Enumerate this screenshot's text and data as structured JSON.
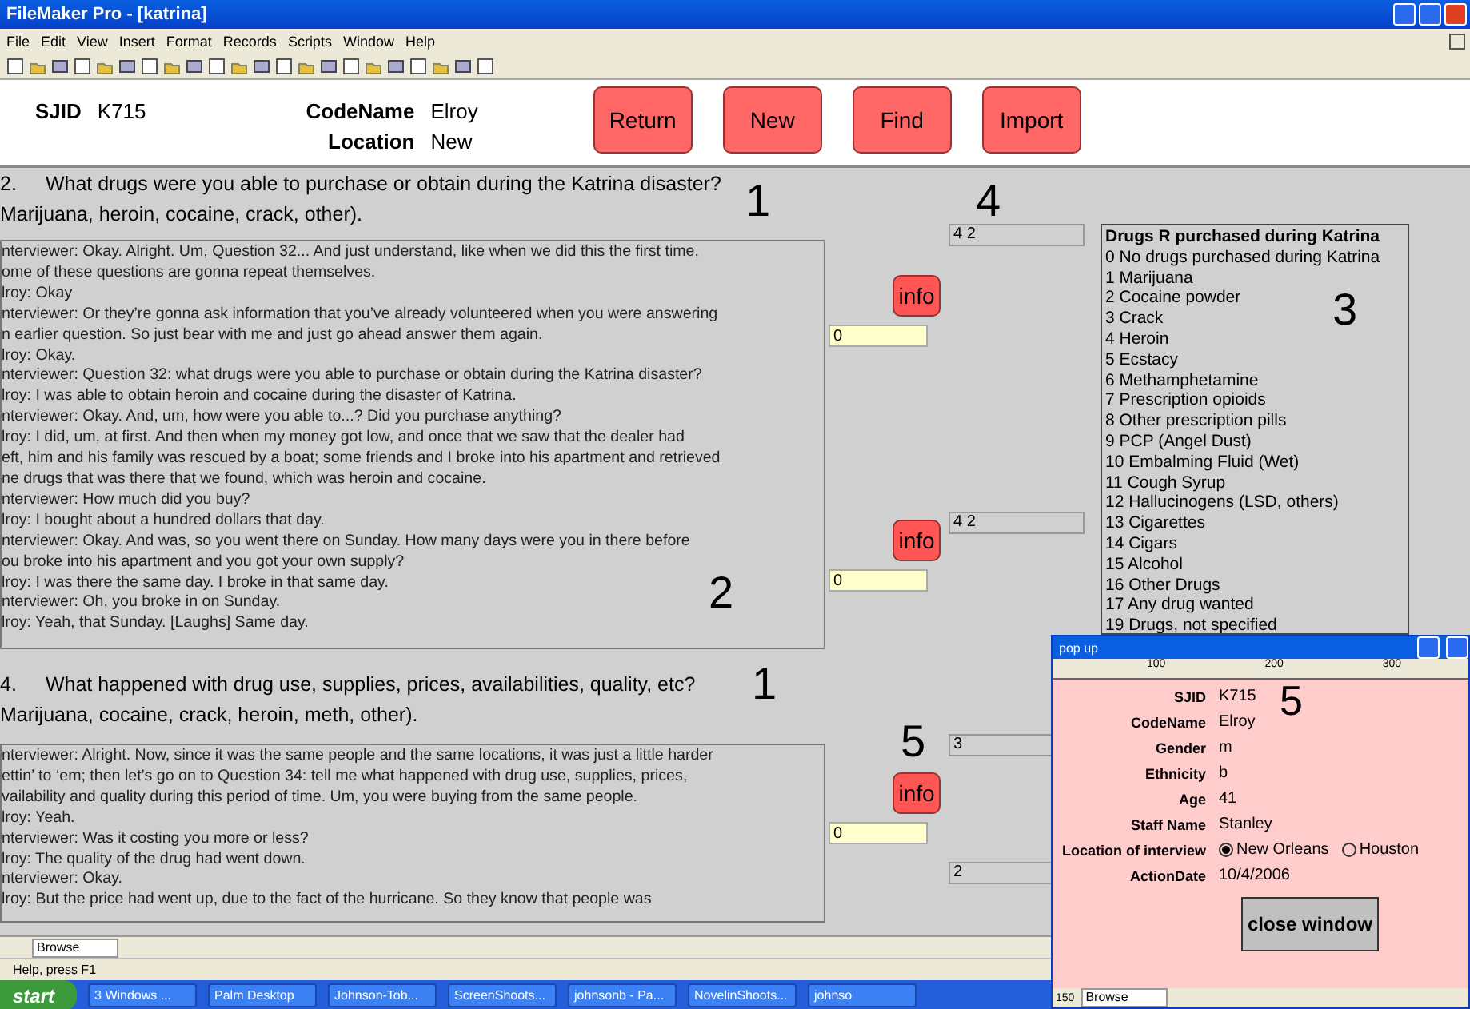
{
  "window": {
    "title": "FileMaker Pro - [katrina]"
  },
  "menu": [
    "File",
    "Edit",
    "View",
    "Insert",
    "Format",
    "Records",
    "Scripts",
    "Window",
    "Help"
  ],
  "header": {
    "fields": [
      {
        "label": "SJID",
        "value": "K715"
      },
      {
        "label": "CodeName",
        "value": "Elroy"
      },
      {
        "label": "Location",
        "value": "New"
      }
    ],
    "buttons": [
      "Return",
      "New",
      "Find",
      "Import"
    ]
  },
  "questions": [
    {
      "number": "2.",
      "text": "What drugs were you able to purchase or obtain during the Katrina disaster?",
      "subtext": "Marijuana, heroin, cocaine, crack, other).",
      "transcript": [
        "nterviewer:  Okay. Alright. Um, Question 32... And just understand, like when we did this the first time,",
        "ome of these questions are gonna repeat themselves.",
        "lroy:  Okay",
        "nterviewer:  Or they’re gonna ask information that you’ve already volunteered when you were answering",
        "n earlier question. So just bear with me and just go ahead answer them again.",
        "lroy:  Okay.",
        "nterviewer:  Question 32: what drugs were you able to purchase or obtain during the Katrina disaster?",
        "lroy:  I was able to obtain heroin and cocaine during the disaster of Katrina.",
        "nterviewer:  Okay. And, um, how were you able to...? Did you purchase anything?",
        "lroy:  I did, um, at first. And then when my money got low, and once that we saw that the dealer had",
        "eft, him and his family was rescued by a boat; some friends and I broke into his apartment and retrieved",
        "ne drugs that was there that we found, which was heroin and cocaine.",
        "nterviewer:  How much did you buy?",
        "lroy:  I bought about a hundred dollars that day.",
        "nterviewer:  Okay. And was, so you went there on Sunday. How many days were you in there before",
        "ou broke into his apartment and you got your own supply?",
        "lroy:  I was there the same day. I broke in that same day.",
        "nterviewer:  Oh, you broke in on Sunday.",
        "lroy:  Yeah, that Sunday. [Laughs] Same day."
      ]
    },
    {
      "number": "4.",
      "text": "What happened with drug use, supplies, prices, availabilities, quality, etc?",
      "subtext": "Marijuana, cocaine, crack, heroin, meth, other).",
      "transcript": [
        "nterviewer:  Alright. Now, since it was the same people and the same locations, it was just a little harder",
        "ettin’ to ‘em; then let’s go on to Question 34: tell me what happened with drug use, supplies, prices,",
        "vailability and quality during this period of time. Um, you were buying from the same people.",
        "lroy:  Yeah.",
        "nterviewer:  Was it costing you more or less?",
        "lroy:  The quality of the drug had went down.",
        "nterviewer:  Okay.",
        "lroy:  But the price had went up, due to the fact of the hurricane. So they know that people was"
      ]
    }
  ],
  "info_groups": [
    {
      "button": "info",
      "code": "0"
    },
    {
      "button": "info",
      "code": "0"
    },
    {
      "button": "info",
      "code": "0"
    }
  ],
  "answers": [
    "4 2",
    "4 2",
    "3",
    "2"
  ],
  "code_list": {
    "title": "Drugs R purchased during Katrina",
    "items": [
      "0 No drugs purchased during Katrina",
      "1 Marijuana",
      "2 Cocaine powder",
      "3 Crack",
      "4 Heroin",
      "5 Ecstacy",
      "6 Methamphetamine",
      "7 Prescription opioids",
      "8 Other prescription pills",
      "9  PCP (Angel Dust)",
      "10 Embalming Fluid (Wet)",
      "11 Cough Syrup",
      "12 Hallucinogens (LSD, others)",
      "13 Cigarettes",
      "14 Cigars",
      "15 Alcohol",
      "16  Other Drugs",
      "17 Any drug wanted",
      "19  Drugs, not specified"
    ]
  },
  "annotations": [
    "1",
    "2",
    "3",
    "4",
    "1",
    "5"
  ],
  "status_bar": {
    "mode": "Browse",
    "help": "Help, press F1"
  },
  "taskbar": {
    "start": "start",
    "items": [
      "3 Windows ...",
      "Palm Desktop",
      "Johnson-Tob...",
      "ScreenShoots...",
      "johnsonb - Pa...",
      "NovelinShoots...",
      "johnso"
    ]
  },
  "popup": {
    "title": "pop up",
    "ruler": [
      "100",
      "200",
      "300"
    ],
    "annotation": "5",
    "fields": [
      {
        "label": "SJID",
        "value": "K715"
      },
      {
        "label": "CodeName",
        "value": "Elroy"
      },
      {
        "label": "Gender",
        "value": "m"
      },
      {
        "label": "Ethnicity",
        "value": "b"
      },
      {
        "label": "Age",
        "value": "41"
      },
      {
        "label": "Staff Name",
        "value": "Stanley"
      }
    ],
    "location": {
      "label": "Location of interview",
      "options": [
        {
          "label": "New Orleans",
          "selected": true
        },
        {
          "label": "Houston",
          "selected": false
        }
      ]
    },
    "date": {
      "label": "ActionDate",
      "value": "10/4/2006"
    },
    "button": "close window",
    "zoom": "150",
    "mode": "Browse"
  }
}
